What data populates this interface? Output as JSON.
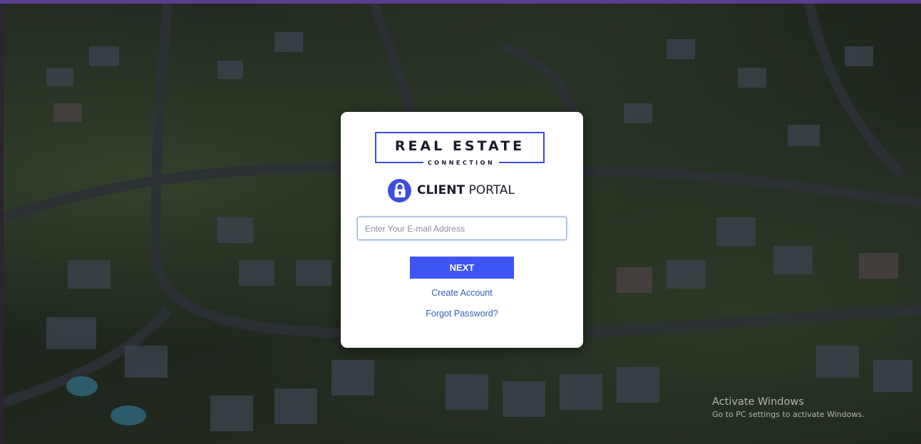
{
  "login": {
    "logo_title": "REAL ESTATE",
    "logo_subtitle": "CONNECTION",
    "portal_strong": "CLIENT",
    "portal_rest": " PORTAL",
    "email_placeholder": "Enter Your E-mail Address",
    "email_value": "",
    "next_label": "NEXT",
    "create_account": "Create Account",
    "forgot_password": "Forgot Password?"
  },
  "watermark": {
    "title": "Activate Windows",
    "subtitle": "Go to PC settings to activate Windows."
  },
  "icons": {
    "lock": "lock-icon",
    "logo": "logo"
  },
  "colors": {
    "accent": "#3d55f4",
    "logo_blue": "#3d4fd8",
    "link": "#2f5fb8"
  }
}
